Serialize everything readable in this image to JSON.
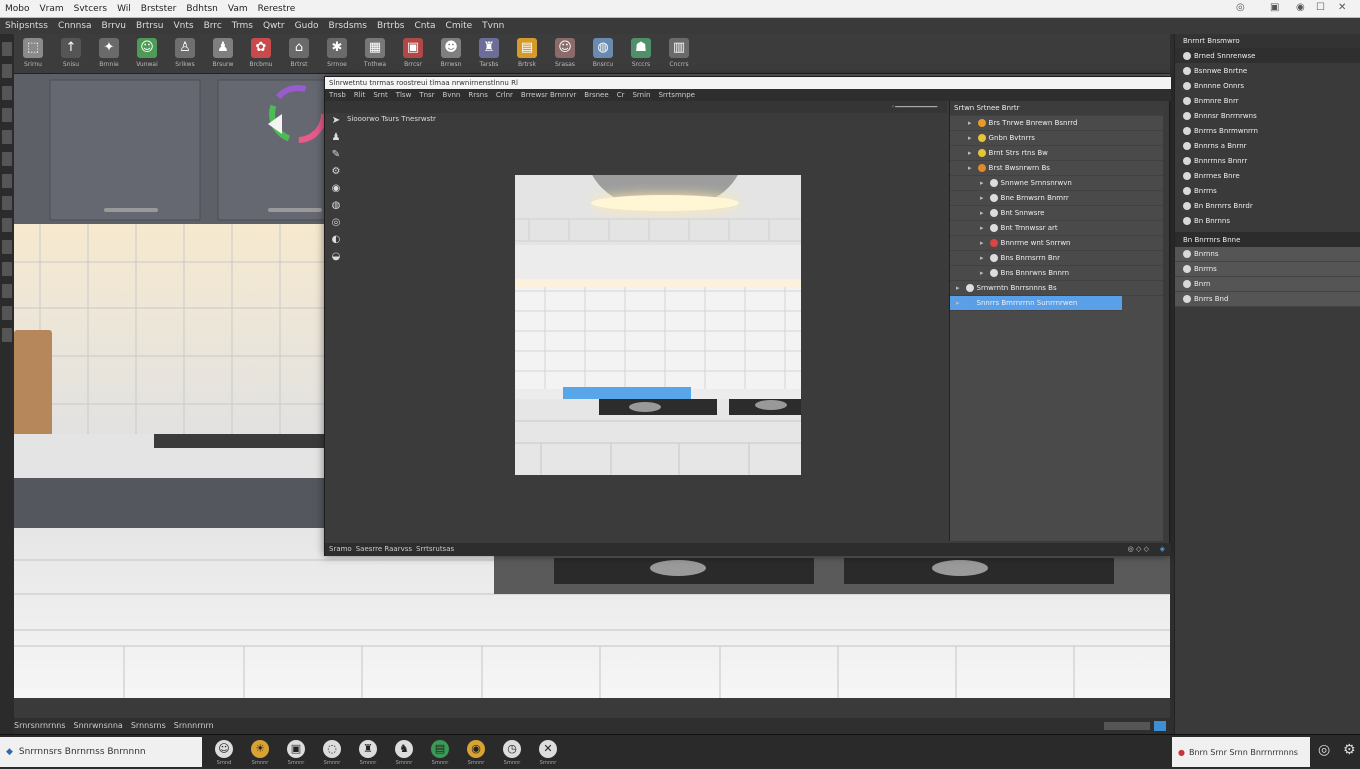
{
  "app": {
    "title_menu": [
      "Mobo",
      "Vram",
      "Svtcers",
      "Wil",
      "Brstster",
      "Bdhtsn",
      "Vam",
      "Rerestre"
    ],
    "window_controls": [
      "minimize-icon",
      "restore-icon",
      "close-icon"
    ]
  },
  "menu2": [
    "Shipsntss",
    "Cnnnsa",
    "Brrvu",
    "Brtrsu",
    "Vnts",
    "Brrc",
    "Trms",
    "Qwtr",
    "Gudo",
    "Brsdsms",
    "Brtrbs",
    "Cnta",
    "Cmite",
    "Tvnn"
  ],
  "toolbar": {
    "items": [
      {
        "icon": "select-icon",
        "label": "Srirnu",
        "color": "#8a8a8a"
      },
      {
        "icon": "arrow-icon",
        "label": "Snisu",
        "color": "#555"
      },
      {
        "icon": "wrench-icon",
        "label": "Brnnie",
        "color": "#6a6a6a"
      },
      {
        "icon": "portrait-icon",
        "label": "Vunwai",
        "color": "#4d9b57"
      },
      {
        "icon": "person-icon",
        "label": "Srikws",
        "color": "#6f6f6f"
      },
      {
        "icon": "figure-icon",
        "label": "Brsurw",
        "color": "#7f7f7f"
      },
      {
        "icon": "paint-icon",
        "label": "Brcbmu",
        "color": "#c94a4a"
      },
      {
        "icon": "camera-icon",
        "label": "Brtrst",
        "color": "#6a6a6a"
      },
      {
        "icon": "tools-icon",
        "label": "Srrnoe",
        "color": "#6a6a6a"
      },
      {
        "icon": "render-icon",
        "label": "Tnthwa",
        "color": "#777"
      },
      {
        "icon": "frame-icon",
        "label": "Brrcsr",
        "color": "#b04848"
      },
      {
        "icon": "avatar-icon",
        "label": "Brrwsn",
        "color": "#7f7f7f"
      },
      {
        "icon": "user-icon",
        "label": "Tarsbs",
        "color": "#6d6d9a"
      },
      {
        "icon": "folder-icon",
        "label": "Brtrsk",
        "color": "#d49a2a"
      },
      {
        "icon": "profile-icon",
        "label": "Srasas",
        "color": "#8a6a6a"
      },
      {
        "icon": "globe-icon",
        "label": "Bnsrcu",
        "color": "#6a8ab0"
      },
      {
        "icon": "badge-icon",
        "label": "Srccrs",
        "color": "#4f8f6a"
      },
      {
        "icon": "chart-icon",
        "label": "Cncrrs",
        "color": "#6a6a6a"
      }
    ]
  },
  "dialog": {
    "title": "Slnrwetntu tnrmas roostreui tlmaa nrwnirnenstlnnu Rl",
    "menu": [
      "Tnsb",
      "Rlit",
      "Srnt",
      "Tlsw",
      "Tnsr",
      "Bvnn",
      "Rrsns",
      "Crlnr",
      "Brrewsr Brnnrvr",
      "Brsnee",
      "Cr",
      "Srnin",
      "Srrtsmnpe"
    ],
    "viewport_label": "Siooorwo Tsurs Tnesrwstr",
    "status_left": [
      "Sramo",
      "Saesrre Raarvss",
      "Srrtsrutsas"
    ],
    "outline_header": "Srtwn Srtnee Bnrtr",
    "outline_rows": [
      {
        "label": "Brs Tnrwe Bnrewn Bsnrrd",
        "dot": "#e89a2a",
        "indent": 1
      },
      {
        "label": "Gnbn Bvtnrrs",
        "dot": "#e8c43a",
        "indent": 1
      },
      {
        "label": "Brnt Strs rtns Bw",
        "dot": "#e8c43a",
        "indent": 1
      },
      {
        "label": "Brst Bwsnrwrn Bs",
        "dot": "#e08a2a",
        "indent": 1
      },
      {
        "label": "Snnwne Srnnsnrwvn",
        "dot": "#ddd",
        "indent": 2
      },
      {
        "label": "Bne Brnwsrn Bnmrr",
        "dot": "#ddd",
        "indent": 2
      },
      {
        "label": "Bnt Snnwsre",
        "dot": "#ddd",
        "indent": 2
      },
      {
        "label": "Bnt Trnnwssr art",
        "dot": "#ddd",
        "indent": 2
      },
      {
        "label": "Bnnrrne wnt Snrrwn",
        "dot": "#d44",
        "indent": 2
      },
      {
        "label": "Bns Bnrnsrrn Bnr",
        "dot": "#ddd",
        "indent": 2
      },
      {
        "label": "Bns Bnnrwns Bnnrn",
        "dot": "#ddd",
        "indent": 2
      },
      {
        "label": "Srnwrntn Bnrrsnnns Bs",
        "dot": "#ddd",
        "indent": 0
      },
      {
        "label": "Snnrrs Bmrnrrnn Sunrrnrwen",
        "dot": "#5aa0e0",
        "indent": 0,
        "selected": true
      }
    ]
  },
  "right_panel": {
    "header": "Bnrnrt Bnsmwro",
    "rows": [
      {
        "label": "Brned Snnrenwse",
        "icon": "folder-icon"
      },
      {
        "label": "Bsnnwe Bnrtne",
        "icon": "doc-icon"
      },
      {
        "label": "Bnnnne Onnrs",
        "icon": "doc-icon"
      },
      {
        "label": "Bnmnre Bnrr",
        "icon": "doc-icon"
      },
      {
        "label": "Bnnnsr Bnrrnrwns",
        "icon": "doc-icon"
      },
      {
        "label": "Bnrrns Bnrmwnrrn",
        "icon": "doc-icon"
      },
      {
        "label": "Bnnrns a Bnrnr",
        "icon": "doc-icon"
      },
      {
        "label": "Bnnrrnns Bnnrr",
        "icon": "doc-icon"
      },
      {
        "label": "Bnrrnes Bnre",
        "icon": "doc-icon"
      },
      {
        "label": "Bnrrns",
        "icon": "doc-icon"
      },
      {
        "label": "Bn Bnrnrrs Bnrdr",
        "icon": "doc-icon"
      },
      {
        "label": "Bn Bnrnns",
        "icon": "doc-icon"
      }
    ],
    "section2_header": "Bn Bnrrnrs Bnne",
    "section2_rows": [
      "Bnrnns",
      "Bnrrns",
      "Bnrn",
      "Bnrrs Bnd"
    ]
  },
  "bottom_status": [
    "Srnrsnrnrnns",
    "Snnrwnsnna",
    "Srnnsrns",
    "Srnnnrnrn"
  ],
  "taskbar": {
    "search_text": "Snrrnnsrs Bnrnrnss Bnrnnnn",
    "items": [
      {
        "icon": "face-icon",
        "label": "Srnnd"
      },
      {
        "icon": "sun-icon",
        "label": "Srnnnr"
      },
      {
        "icon": "monitor-icon",
        "label": "Srnnnr"
      },
      {
        "icon": "bulb-icon",
        "label": "Srnnnr"
      },
      {
        "icon": "users-icon",
        "label": "Srnnnr"
      },
      {
        "icon": "runner-icon",
        "label": "Srnnnr"
      },
      {
        "icon": "chart-icon",
        "label": "Srnnnr"
      },
      {
        "icon": "gold-icon",
        "label": "Srnnnr"
      },
      {
        "icon": "clock-icon",
        "label": "Srnnnr"
      },
      {
        "icon": "cross-icon",
        "label": "Srnnnr"
      }
    ],
    "right_text": "Bnrn Srnr Srnn Bnrrnrrnnns"
  }
}
